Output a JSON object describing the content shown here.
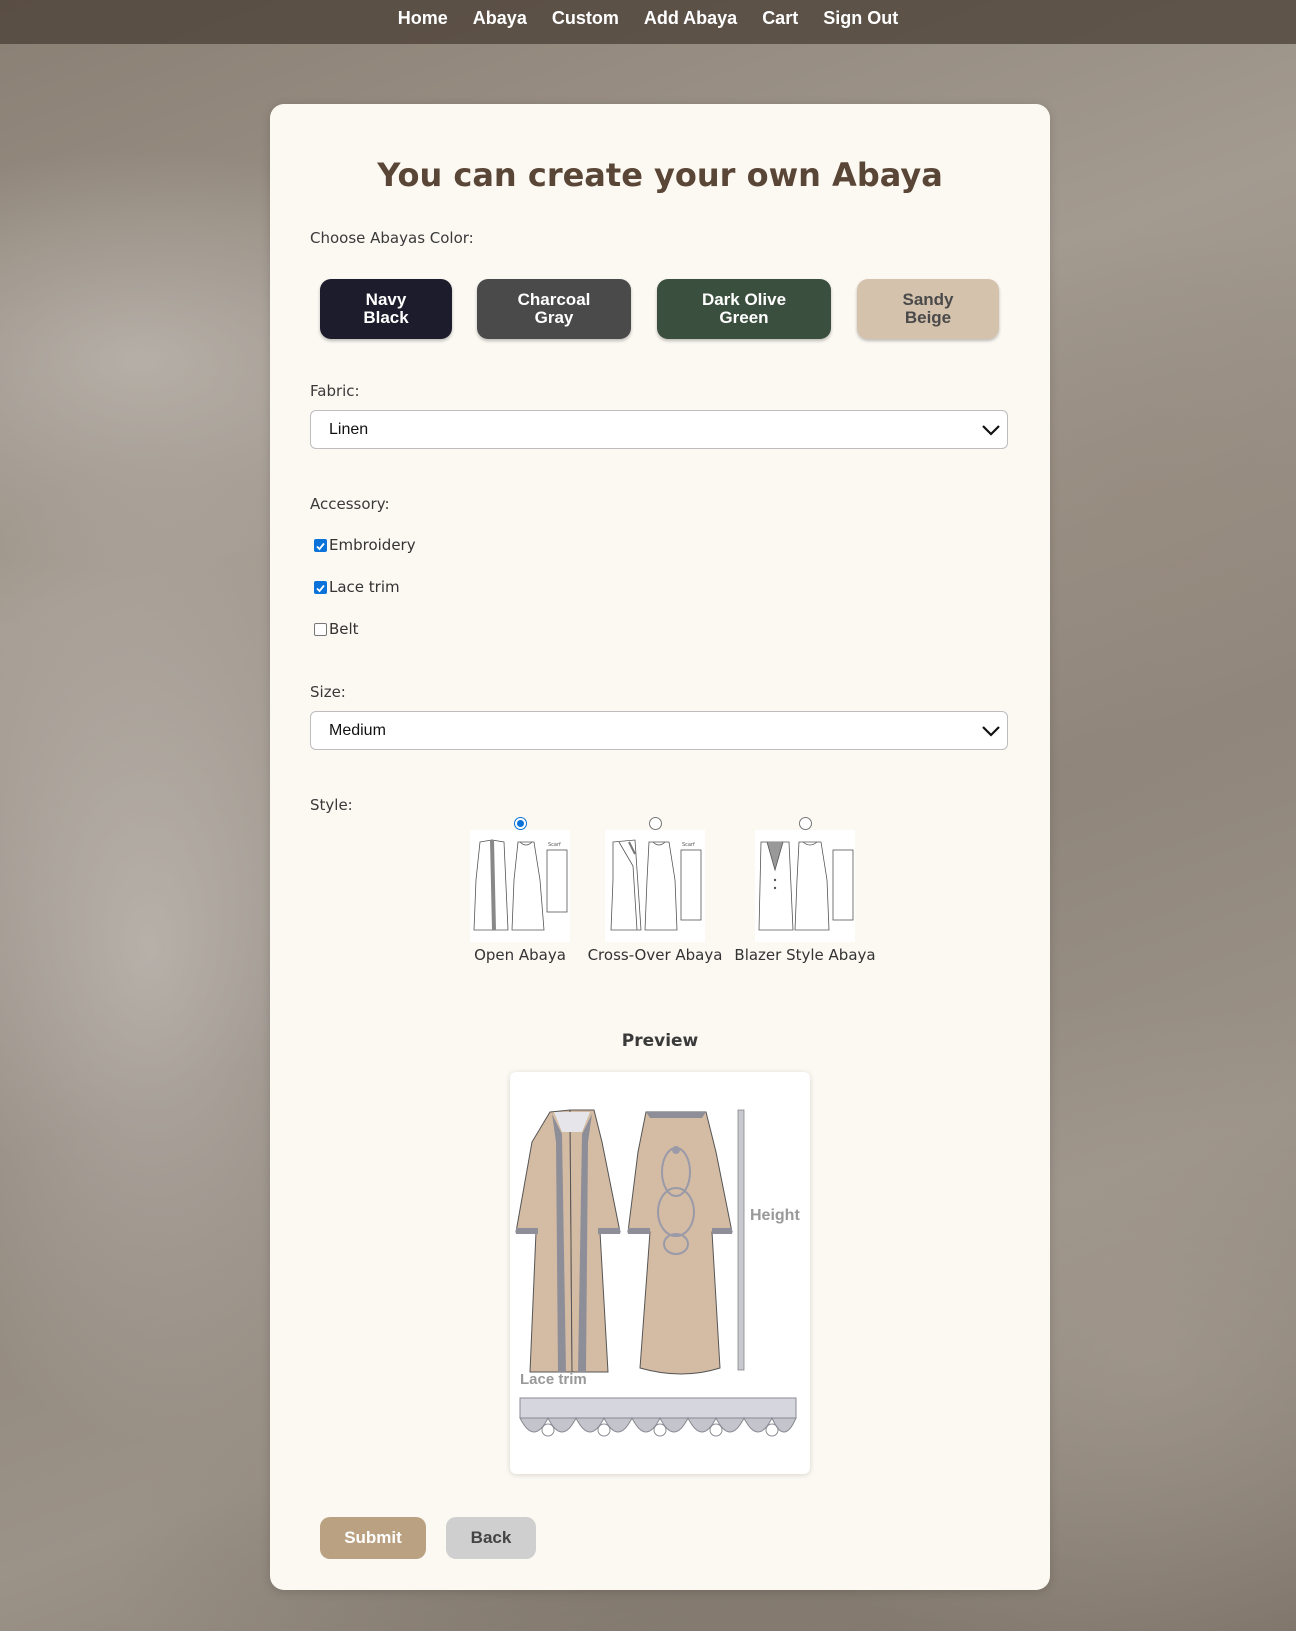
{
  "nav": {
    "items": [
      "Home",
      "Abaya",
      "Custom",
      "Add Abaya",
      "Cart",
      "Sign Out"
    ]
  },
  "form": {
    "title": "You can create your own Abaya",
    "color_label": "Choose Abayas Color:",
    "colors": [
      {
        "line1": "Navy",
        "line2": "Black",
        "hex": "#1d1c2c",
        "text_color": "#ffffff"
      },
      {
        "line1": "Charcoal",
        "line2": "Gray",
        "hex": "#4a4a4a",
        "text_color": "#ffffff"
      },
      {
        "line1": "Dark Olive",
        "line2": "Green",
        "hex": "#3b4f3e",
        "text_color": "#ffffff"
      },
      {
        "line1": "Sandy",
        "line2": "Beige",
        "hex": "#d5c2ad",
        "text_color": "#4a4a4a"
      }
    ],
    "fabric_label": "Fabric:",
    "fabric_value": "Linen",
    "accessory_label": "Accessory:",
    "accessories": [
      {
        "label": "Embroidery",
        "checked": true
      },
      {
        "label": "Lace trim",
        "checked": true
      },
      {
        "label": "Belt",
        "checked": false
      }
    ],
    "size_label": "Size:",
    "size_value": "Medium",
    "style_label": "Style:",
    "styles": [
      {
        "label": "Open Abaya",
        "selected": true
      },
      {
        "label": "Cross-Over Abaya",
        "selected": false
      },
      {
        "label": "Blazer Style Abaya",
        "selected": false
      }
    ],
    "preview_title": "Preview",
    "preview_height_text": "Height",
    "preview_lace_text": "Lace trim",
    "submit_label": "Submit",
    "back_label": "Back",
    "submit_color": "#b9a182",
    "back_color": "#cfcfcf"
  }
}
